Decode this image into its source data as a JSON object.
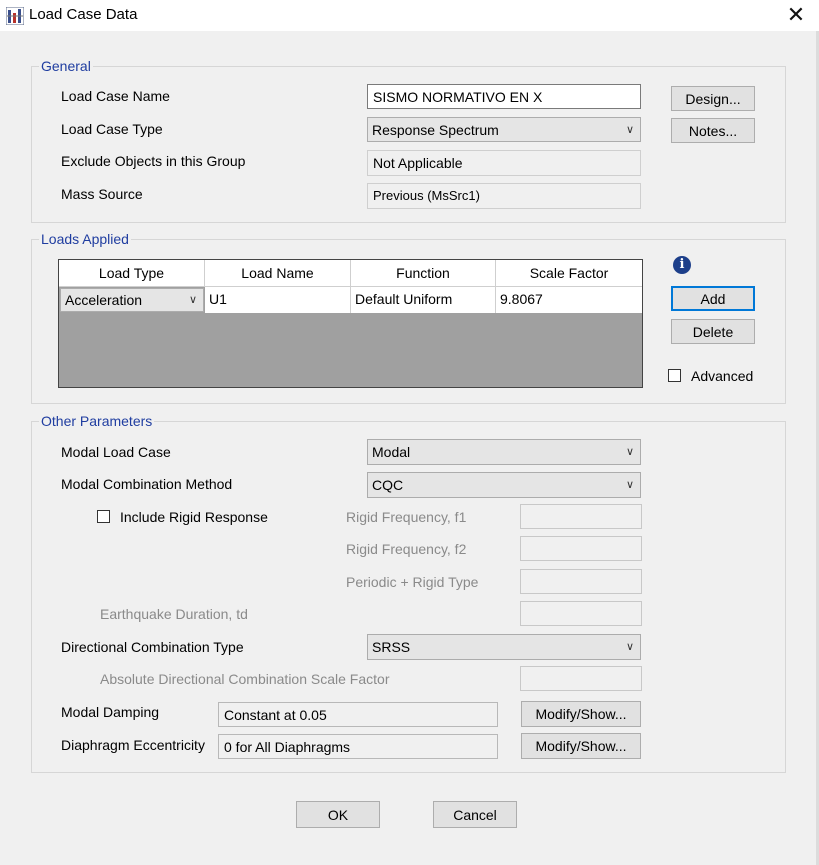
{
  "window": {
    "title": "Load Case Data"
  },
  "general": {
    "group_title": "General",
    "load_case_name_label": "Load Case Name",
    "load_case_name_value": "SISMO NORMATIVO EN X",
    "load_case_type_label": "Load Case Type",
    "load_case_type_value": "Response Spectrum",
    "exclude_objects_label": "Exclude Objects in this Group",
    "exclude_objects_value": "Not Applicable",
    "mass_source_label": "Mass Source",
    "mass_source_value": "Previous  (MsSrc1)",
    "design_button": "Design...",
    "notes_button": "Notes..."
  },
  "loads_applied": {
    "group_title": "Loads Applied",
    "columns": [
      "Load Type",
      "Load Name",
      "Function",
      "Scale Factor"
    ],
    "rows": [
      {
        "load_type": "Acceleration",
        "load_name": "U1",
        "function": "Default Uniform",
        "scale_factor": "9.8067"
      }
    ],
    "add_button": "Add",
    "delete_button": "Delete",
    "advanced_label": "Advanced",
    "advanced_checked": false
  },
  "other_parameters": {
    "group_title": "Other Parameters",
    "modal_load_case_label": "Modal Load Case",
    "modal_load_case_value": "Modal",
    "modal_combination_label": "Modal Combination Method",
    "modal_combination_value": "CQC",
    "include_rigid_label": "Include Rigid Response",
    "include_rigid_checked": false,
    "rigid_f1_label": "Rigid Frequency, f1",
    "rigid_f2_label": "Rigid Frequency, f2",
    "periodic_rigid_label": "Periodic + Rigid Type",
    "earthquake_duration_label": "Earthquake Duration, td",
    "directional_combination_label": "Directional Combination Type",
    "directional_combination_value": "SRSS",
    "absolute_scale_label": "Absolute Directional Combination Scale Factor",
    "modal_damping_label": "Modal Damping",
    "modal_damping_value": "Constant at 0.05",
    "diaphragm_label": "Diaphragm Eccentricity",
    "diaphragm_value": "0 for All Diaphragms",
    "modify_show_button": "Modify/Show..."
  },
  "footer": {
    "ok_button": "OK",
    "cancel_button": "Cancel"
  }
}
